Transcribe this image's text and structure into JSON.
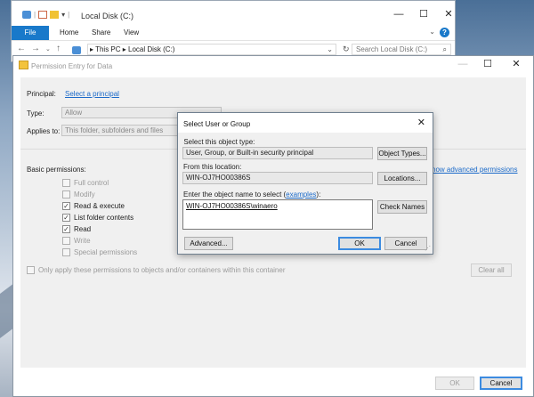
{
  "explorer": {
    "title": "Local Disk (C:)",
    "tabs": [
      "File",
      "Home",
      "Share",
      "View"
    ],
    "address": "▸ This PC ▸ Local Disk (C:)",
    "search_placeholder": "Search Local Disk (C:)",
    "minimize": "—",
    "maximize": "☐",
    "close": "✕"
  },
  "permission": {
    "title": "Permission Entry for Data",
    "principal_label": "Principal:",
    "principal_link": "Select a principal",
    "type_label": "Type:",
    "type_value": "Allow",
    "applies_label": "Applies to:",
    "applies_value": "This folder, subfolders and files",
    "basic_label": "Basic permissions:",
    "advanced_link": "how advanced permissions",
    "permissions": [
      {
        "label": "Full control",
        "checked": false
      },
      {
        "label": "Modify",
        "checked": false
      },
      {
        "label": "Read & execute",
        "checked": true
      },
      {
        "label": "List folder contents",
        "checked": true
      },
      {
        "label": "Read",
        "checked": true
      },
      {
        "label": "Write",
        "checked": false
      },
      {
        "label": "Special permissions",
        "checked": false
      }
    ],
    "only_apply": "Only apply these permissions to objects and/or containers within this container",
    "clear_all": "Clear all",
    "ok": "OK",
    "cancel": "Cancel"
  },
  "select_dialog": {
    "title": "Select User or Group",
    "object_type_label": "Select this object type:",
    "object_type_value": "User, Group, or Built-in security principal",
    "object_types_btn": "Object Types...",
    "location_label": "From this location:",
    "location_value": "WIN-OJ7HO00386S",
    "locations_btn": "Locations...",
    "enter_label": "Enter the object name to select (",
    "examples_link": "examples",
    "enter_label_end": "):",
    "object_name": "WIN-OJ7HO00386S\\winaero",
    "check_names_btn": "Check Names",
    "advanced_btn": "Advanced...",
    "ok": "OK",
    "cancel": "Cancel"
  },
  "colors": {
    "accent": "#1979ca",
    "link": "#1b6ac9",
    "dialog_bg": "#f0f0f0"
  }
}
